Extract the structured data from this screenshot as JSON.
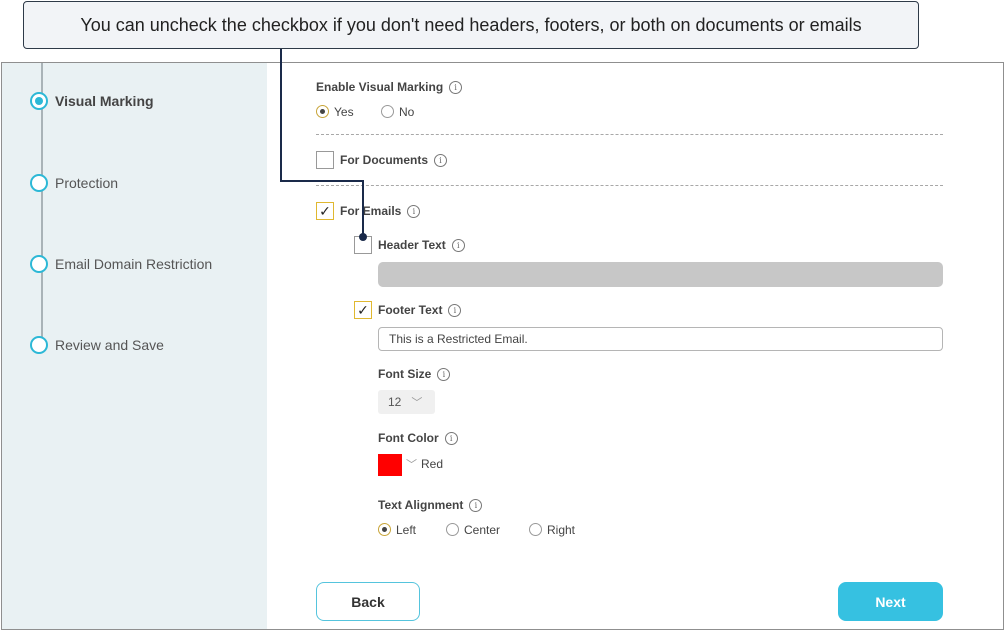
{
  "callout": {
    "text": "You can uncheck the checkbox if you don't need headers, footers, or both on documents or emails"
  },
  "steps": [
    {
      "label": "Visual Marking",
      "active": true
    },
    {
      "label": "Protection",
      "active": false
    },
    {
      "label": "Email Domain Restriction",
      "active": false
    },
    {
      "label": "Review and Save",
      "active": false
    }
  ],
  "form": {
    "enable_visual_marking": {
      "label": "Enable Visual Marking",
      "options": [
        "Yes",
        "No"
      ],
      "selected": "Yes"
    },
    "for_documents": {
      "label": "For Documents",
      "checked": false
    },
    "for_emails": {
      "label": "For Emails",
      "checked": true
    },
    "header_text": {
      "label": "Header Text",
      "checked": false,
      "value": ""
    },
    "footer_text": {
      "label": "Footer Text",
      "checked": true,
      "value": "This is a Restricted Email."
    },
    "font_size": {
      "label": "Font Size",
      "value": "12"
    },
    "font_color": {
      "label": "Font Color",
      "value": "Red",
      "hex": "#ff0000"
    },
    "text_alignment": {
      "label": "Text Alignment",
      "options": [
        "Left",
        "Center",
        "Right"
      ],
      "selected": "Left"
    },
    "info_glyph": "i",
    "check_glyph": "✓",
    "chevron_glyph": "﹀"
  },
  "buttons": {
    "back": "Back",
    "next": "Next"
  },
  "colors": {
    "accent": "#36c1e1",
    "checkbox_border_checked": "#e0b830",
    "sidebar_bg": "#e9f1f3"
  }
}
